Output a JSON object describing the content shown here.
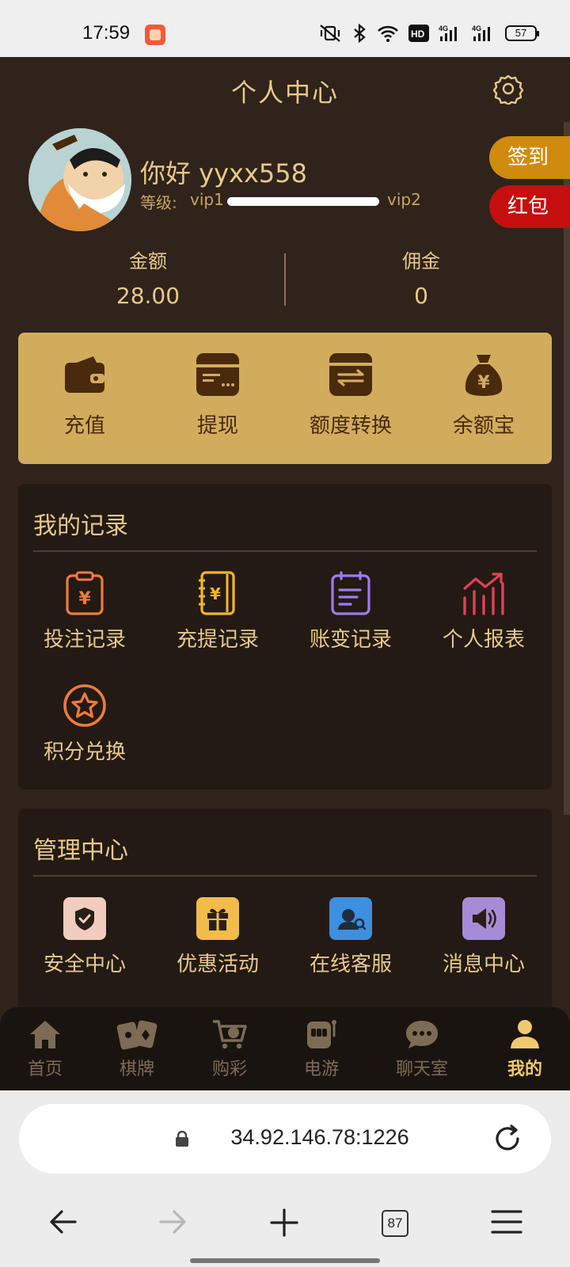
{
  "status_bar": {
    "time": "17:59",
    "network_1": "4G",
    "network_2": "4G",
    "hd_badge": "HD",
    "battery": "57"
  },
  "header": {
    "title": "个人中心",
    "settings_icon": "gear-icon"
  },
  "profile": {
    "greeting": "你好 yyxx558",
    "level_label": "等级:",
    "level_from": "vip1",
    "level_to": "vip2",
    "level_progress": 1.0,
    "sign_in_label": "签到",
    "red_packet_label": "红包"
  },
  "stats": {
    "balance_label": "金额",
    "balance_value": "28.00",
    "commission_label": "佣金",
    "commission_value": "0"
  },
  "wallet_actions": [
    {
      "label": "充值",
      "icon": "wallet-icon"
    },
    {
      "label": "提现",
      "icon": "card-withdraw-icon"
    },
    {
      "label": "额度转换",
      "icon": "transfer-icon"
    },
    {
      "label": "余额宝",
      "icon": "money-bag-icon"
    }
  ],
  "records": {
    "title": "我的记录",
    "items": [
      {
        "label": "投注记录",
        "icon": "clipboard-yuan-icon"
      },
      {
        "label": "充提记录",
        "icon": "notebook-yuan-icon"
      },
      {
        "label": "账变记录",
        "icon": "calendar-list-icon"
      },
      {
        "label": "个人报表",
        "icon": "chart-trend-icon"
      },
      {
        "label": "积分兑换",
        "icon": "star-circle-icon"
      }
    ]
  },
  "management": {
    "title": "管理中心",
    "items": [
      {
        "label": "安全中心",
        "icon": "shield-check-icon"
      },
      {
        "label": "优惠活动",
        "icon": "gift-icon"
      },
      {
        "label": "在线客服",
        "icon": "customer-service-icon"
      },
      {
        "label": "消息中心",
        "icon": "megaphone-icon"
      }
    ]
  },
  "bottom_nav": [
    {
      "label": "首页",
      "icon": "home-icon"
    },
    {
      "label": "棋牌",
      "icon": "cards-icon"
    },
    {
      "label": "购彩",
      "icon": "lottery-cart-icon"
    },
    {
      "label": "电游",
      "icon": "slot-machine-icon"
    },
    {
      "label": "聊天室",
      "icon": "chat-icon"
    },
    {
      "label": "我的",
      "icon": "user-icon",
      "active": true
    }
  ],
  "browser": {
    "url": "34.92.146.78:1226",
    "tab_count": "87"
  },
  "colors": {
    "background": "#2f231b",
    "gold_text": "#e7c98b",
    "card_gold": "#d1ac5d",
    "sign_in": "#d08b0e",
    "red_packet": "#c60f0f"
  }
}
